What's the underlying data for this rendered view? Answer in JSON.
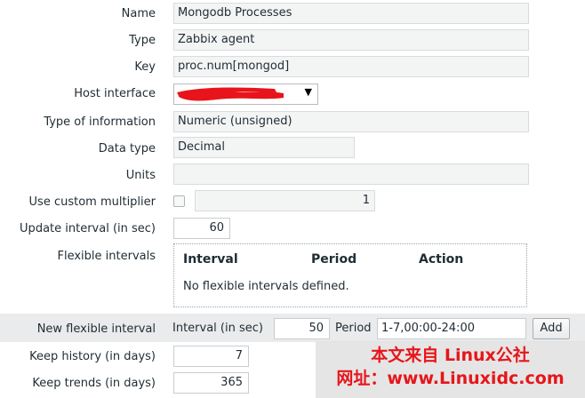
{
  "form": {
    "name": {
      "label": "Name",
      "value": "Mongodb Processes"
    },
    "type": {
      "label": "Type",
      "value": "Zabbix agent"
    },
    "key": {
      "label": "Key",
      "value": "proc.num[mongod]"
    },
    "host_interface": {
      "label": "Host interface",
      "value": ""
    },
    "type_of_information": {
      "label": "Type of information",
      "value": "Numeric (unsigned)"
    },
    "data_type": {
      "label": "Data type",
      "value": "Decimal"
    },
    "units": {
      "label": "Units",
      "value": ""
    },
    "custom_multiplier": {
      "label": "Use custom multiplier",
      "checked": false,
      "value": "1"
    },
    "update_interval": {
      "label": "Update interval (in sec)",
      "value": "60"
    },
    "flexible_intervals": {
      "label": "Flexible intervals",
      "columns": [
        "Interval",
        "Period",
        "Action"
      ],
      "empty_text": "No flexible intervals defined."
    },
    "new_flexible_interval": {
      "label": "New flexible interval",
      "interval_label": "Interval (in sec)",
      "interval_value": "50",
      "period_label": "Period",
      "period_value": "1-7,00:00-24:00",
      "add_label": "Add"
    },
    "keep_history": {
      "label": "Keep history (in days)",
      "value": "7"
    },
    "keep_trends": {
      "label": "Keep trends (in days)",
      "value": "365"
    }
  },
  "watermark": {
    "line1": "本文来自 Linux公社",
    "line2": "网址：www.Linuxidc.com"
  },
  "colors": {
    "redaction": "#e8141b",
    "band": "#e9ebec",
    "watermark_text": "#e6161b"
  },
  "icons": {
    "dropdown": "caret-down-icon"
  }
}
